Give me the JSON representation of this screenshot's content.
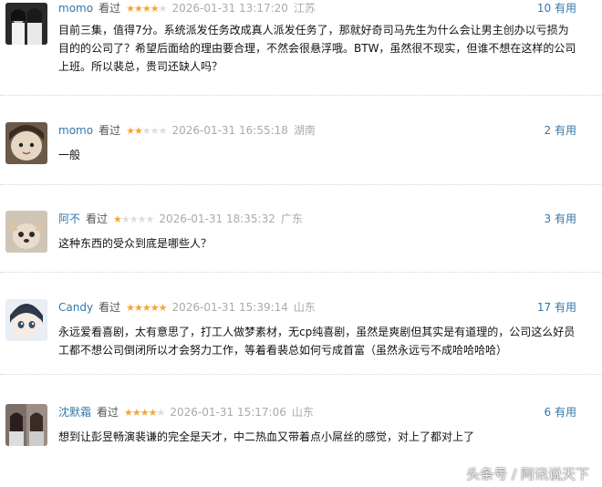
{
  "reviews": [
    {
      "user": "momo",
      "watched": "看过",
      "stars": 4,
      "date": "2026-01-31 13:17:20",
      "location": "江苏",
      "useful": "10 有用",
      "content": "目前三集，值得7分。系统派发任务改成真人派发任务了，那就好奇司马先生为什么会让男主创办以亏损为目的的公司了？希望后面给的理由要合理，不然会很悬浮哦。BTW，虽然很不现实，但谁不想在这样的公司上班。所以裴总，贵司还缺人吗？"
    },
    {
      "user": "momo",
      "watched": "看过",
      "stars": 2,
      "date": "2026-01-31 16:55:18",
      "location": "湖南",
      "useful": "2 有用",
      "content": "一般"
    },
    {
      "user": "阿不",
      "watched": "看过",
      "stars": 1,
      "date": "2026-01-31 18:35:32",
      "location": "广东",
      "useful": "3 有用",
      "content": "这种东西的受众到底是哪些人？"
    },
    {
      "user": "Candy",
      "watched": "看过",
      "stars": 5,
      "date": "2026-01-31 15:39:14",
      "location": "山东",
      "useful": "17 有用",
      "content": "永远爱看喜剧，太有意思了，打工人做梦素材，无cp纯喜剧，虽然是爽剧但其实是有道理的，公司这么好员工都不想公司倒闭所以才会努力工作，等着看裴总如何亏成首富（虽然永远亏不成哈哈哈哈）"
    },
    {
      "user": "沈默霜",
      "watched": "看过",
      "stars": 4,
      "date": "2026-01-31 15:17:06",
      "location": "山东",
      "useful": "6 有用",
      "content": "想到让彭昱畅演裴谦的完全是天才，中二热血又带着点小屌丝的感觉，对上了都对上了"
    }
  ],
  "watermark": "头条号 / 阿讯说天下",
  "colors": {
    "username": "#3377aa",
    "star_on": "#f4a634",
    "star_off": "#dcdcdc",
    "meta": "#aaaaaa"
  }
}
